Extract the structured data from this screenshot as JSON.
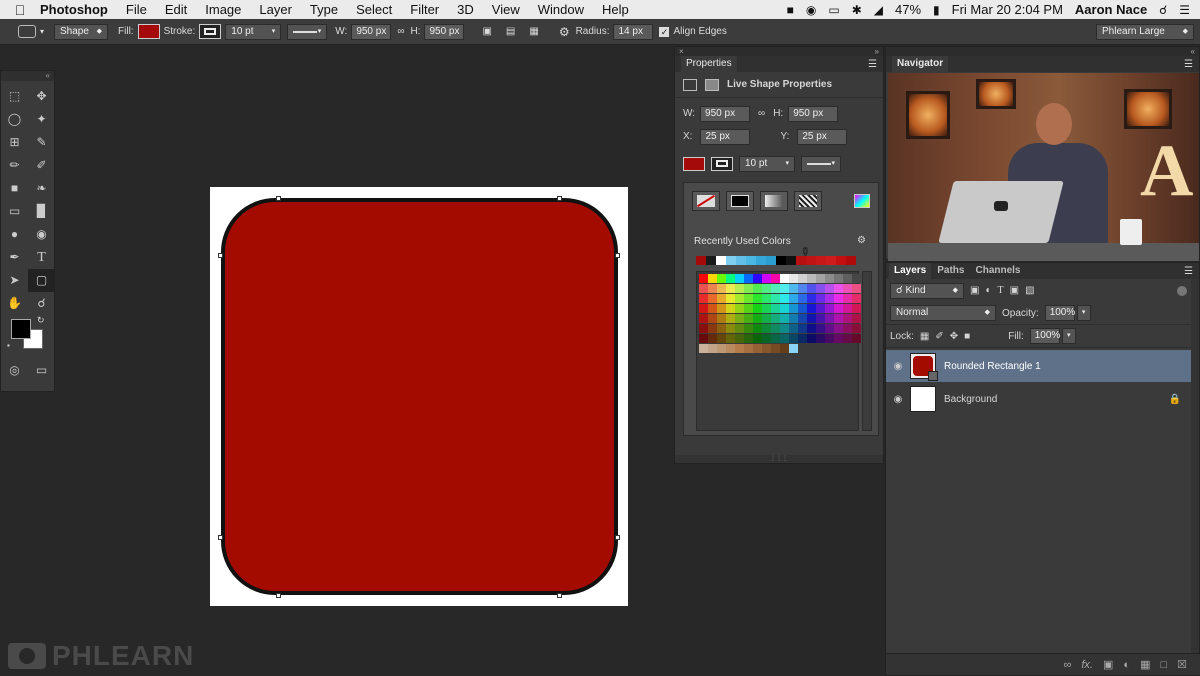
{
  "menubar": {
    "app": "Photoshop",
    "menus": [
      "File",
      "Edit",
      "Image",
      "Layer",
      "Type",
      "Select",
      "Filter",
      "3D",
      "View",
      "Window",
      "Help"
    ],
    "battery": "47%",
    "datetime": "Fri Mar 20  2:04 PM",
    "user": "Aaron Nace"
  },
  "options": {
    "tool_mode": "Shape",
    "fill_label": "Fill:",
    "stroke_label": "Stroke:",
    "stroke_width": "10 pt",
    "w_label": "W:",
    "w_value": "950 px",
    "h_label": "H:",
    "h_value": "950 px",
    "radius_label": "Radius:",
    "radius_value": "14 px",
    "align_edges": "Align Edges",
    "workspace": "Phlearn Large",
    "fill_color": "#a50a0a"
  },
  "watermark": "PHLEARN",
  "properties": {
    "tab": "Properties",
    "title": "Live Shape Properties",
    "w_label": "W:",
    "w": "950 px",
    "h_label": "H:",
    "h": "950 px",
    "x_label": "X:",
    "x": "25 px",
    "y_label": "Y:",
    "y": "25 px",
    "stroke": "10 pt",
    "recent_label": "Recently Used Colors",
    "recent_colors": [
      "#a50a0a",
      "#1a1a1a",
      "#ffffff",
      "#7fd0f0",
      "#62c0e8",
      "#4ab8e0",
      "#36a8d8",
      "#2a9fd0",
      "#000000",
      "#111111",
      "#b81010",
      "#c01414",
      "#c81818",
      "#d01c1c",
      "#c41010",
      "#b00a0a"
    ]
  },
  "navigator": {
    "tab": "Navigator"
  },
  "layers": {
    "tabs": [
      "Layers",
      "Paths",
      "Channels"
    ],
    "filter": "Kind",
    "blend": "Normal",
    "opacity_label": "Opacity:",
    "opacity": "100%",
    "lock_label": "Lock:",
    "fill_label": "Fill:",
    "fill": "100%",
    "items": [
      {
        "name": "Rounded Rectangle 1",
        "selected": true
      },
      {
        "name": "Background",
        "selected": false
      }
    ]
  }
}
